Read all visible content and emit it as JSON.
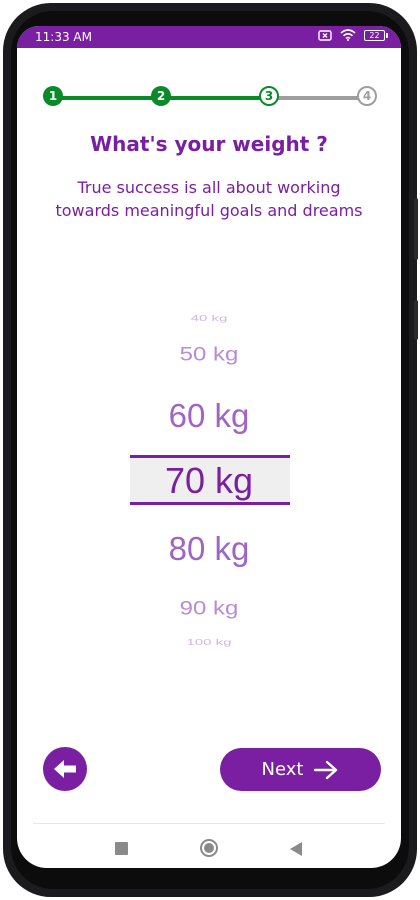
{
  "status_bar": {
    "time": "11:33 AM",
    "battery": "22",
    "icons": [
      "close-box-icon",
      "wifi-icon",
      "battery-icon"
    ]
  },
  "stepper": {
    "steps": [
      {
        "label": "1",
        "state": "completed"
      },
      {
        "label": "2",
        "state": "completed"
      },
      {
        "label": "3",
        "state": "current"
      },
      {
        "label": "4",
        "state": "upcoming"
      }
    ],
    "colors": {
      "completed": "#0b8a2a",
      "upcoming": "#9e9e9e"
    }
  },
  "header": {
    "title": "What's your weight ?",
    "subtitle_line1": "True success is all about working",
    "subtitle_line2": "towards meaningful goals and dreams"
  },
  "weight_picker": {
    "options": [
      "40 kg",
      "50 kg",
      "60 kg",
      "70 kg",
      "80 kg",
      "90 kg",
      "100 kg"
    ],
    "selected": "70 kg"
  },
  "footer": {
    "back_icon": "arrow-left-icon",
    "next_label": "Next",
    "next_icon": "arrow-right-icon"
  },
  "nav_bar": {
    "icons": [
      "recents-square-icon",
      "home-circle-icon",
      "back-triangle-icon"
    ]
  },
  "colors": {
    "brand": "#7a1fa2",
    "picker_text": "#9b5cbf",
    "selected_text": "#7a1fa2",
    "selected_bg": "#efefef"
  }
}
